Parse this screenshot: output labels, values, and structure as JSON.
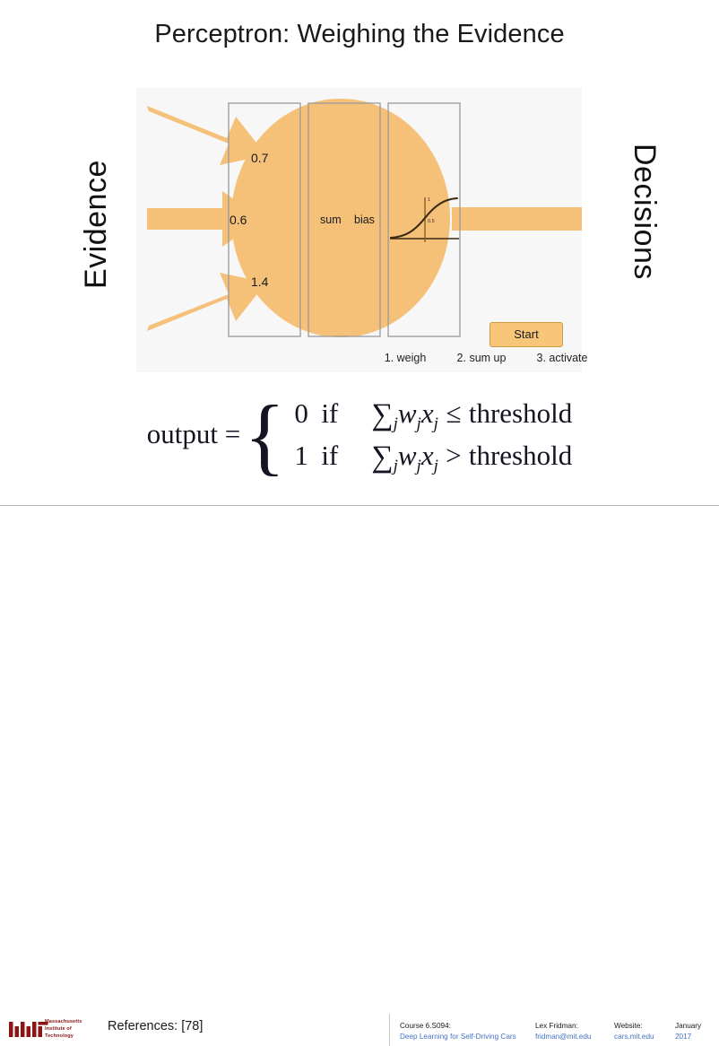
{
  "slide": {
    "title": "Perceptron: Weighing the Evidence"
  },
  "labels": {
    "left_axis": "Evidence",
    "right_axis": "Decisions"
  },
  "diagram": {
    "steps": [
      {
        "label": "1. weigh"
      },
      {
        "label": "2. sum up"
      },
      {
        "label": "3. activate"
      }
    ],
    "weights": [
      "0.7",
      "0.6",
      "1.4"
    ],
    "operations": {
      "sum": "sum",
      "bias": "bias"
    },
    "activation": {
      "name": "sigmoid-curve",
      "tick_top": "1",
      "tick_mid": "0.5"
    },
    "start_button": "Start",
    "colors": {
      "orange_fill": "#f5c078",
      "orange_button": "#f8c678",
      "button_border": "#cf9a43",
      "panel_background": "#f7f7f7",
      "box_border": "#9a9a9a",
      "curve": "#3a2a12"
    }
  },
  "formula": {
    "lhs": "output =",
    "rows": [
      {
        "value": "0",
        "if": "if",
        "sum": "∑",
        "sum_sub": "j",
        "w": "w",
        "w_sub": "j",
        "x": "x",
        "x_sub": "j",
        "relation": "≤",
        "threshold": "threshold"
      },
      {
        "value": "1",
        "if": "if",
        "sum": "∑",
        "sum_sub": "j",
        "w": "w",
        "w_sub": "j",
        "x": "x",
        "x_sub": "j",
        "relation": ">",
        "threshold": "threshold"
      }
    ]
  },
  "footer": {
    "logo_text_lines": [
      "Massachusetts",
      "Institute of",
      "Technology"
    ],
    "references": "References: [78]",
    "columns": [
      {
        "line1": "Course 6.S094:",
        "line2": "Deep Learning for Self-Driving Cars"
      },
      {
        "line1": "Lex Fridman:",
        "line2": "fridman@mit.edu"
      },
      {
        "line1": "Website:",
        "line2": "cars.mit.edu"
      },
      {
        "line1": "January",
        "line2": "2017"
      }
    ]
  }
}
